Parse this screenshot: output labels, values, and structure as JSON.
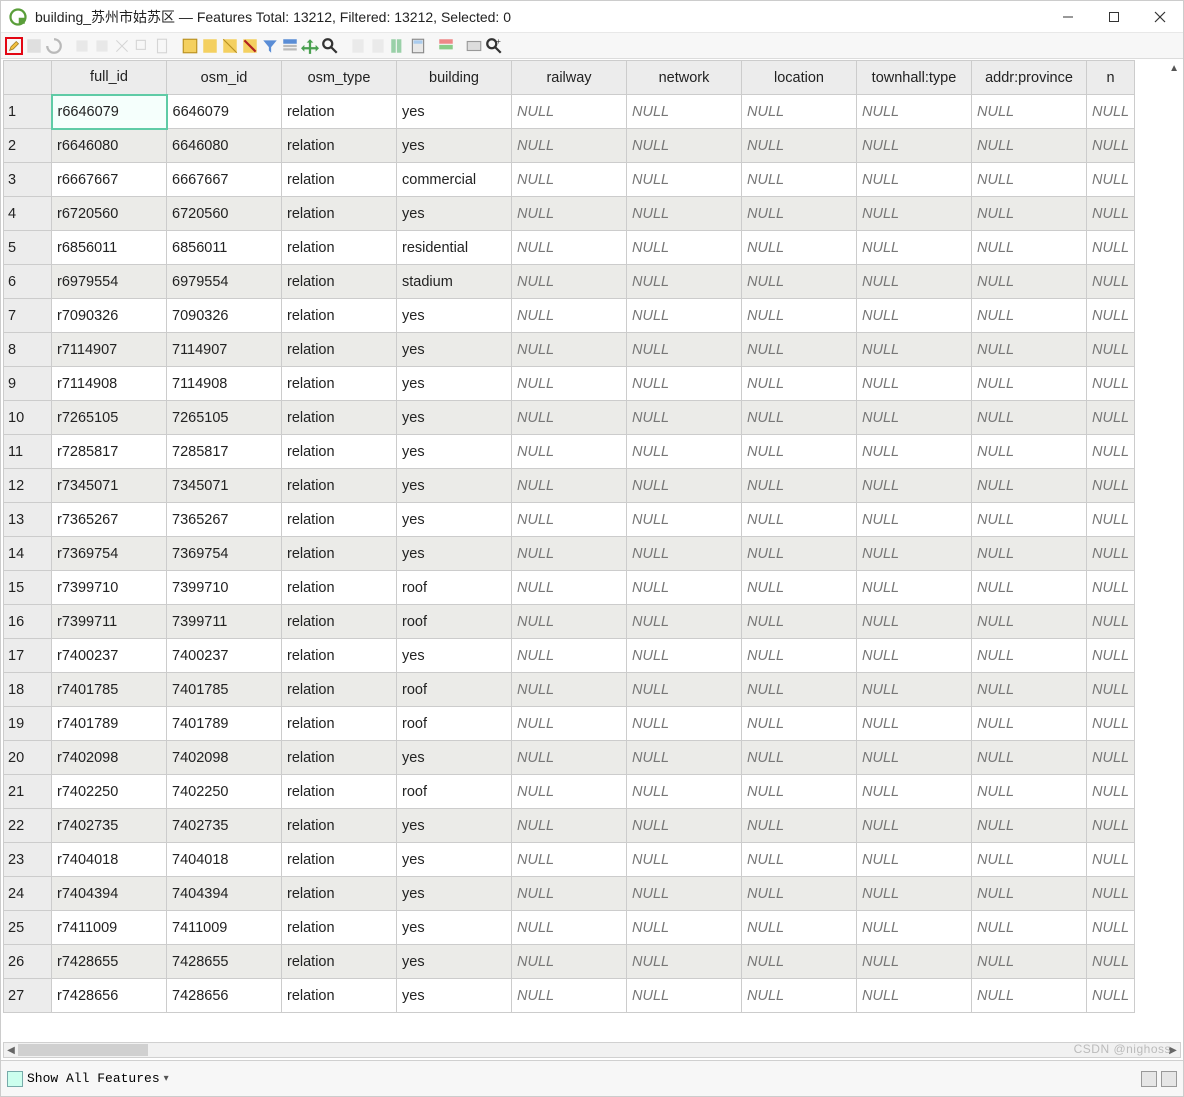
{
  "window": {
    "title": "building_苏州市姑苏区 — Features Total: 13212, Filtered: 13212, Selected: 0"
  },
  "columns": [
    "full_id",
    "osm_id",
    "osm_type",
    "building",
    "railway",
    "network",
    "location",
    "townhall:type",
    "addr:province",
    "n"
  ],
  "null_label": "NULL",
  "rows": [
    {
      "n": 1,
      "full_id": "r6646079",
      "osm_id": "6646079",
      "osm_type": "relation",
      "building": "yes"
    },
    {
      "n": 2,
      "full_id": "r6646080",
      "osm_id": "6646080",
      "osm_type": "relation",
      "building": "yes"
    },
    {
      "n": 3,
      "full_id": "r6667667",
      "osm_id": "6667667",
      "osm_type": "relation",
      "building": "commercial"
    },
    {
      "n": 4,
      "full_id": "r6720560",
      "osm_id": "6720560",
      "osm_type": "relation",
      "building": "yes"
    },
    {
      "n": 5,
      "full_id": "r6856011",
      "osm_id": "6856011",
      "osm_type": "relation",
      "building": "residential"
    },
    {
      "n": 6,
      "full_id": "r6979554",
      "osm_id": "6979554",
      "osm_type": "relation",
      "building": "stadium"
    },
    {
      "n": 7,
      "full_id": "r7090326",
      "osm_id": "7090326",
      "osm_type": "relation",
      "building": "yes"
    },
    {
      "n": 8,
      "full_id": "r7114907",
      "osm_id": "7114907",
      "osm_type": "relation",
      "building": "yes"
    },
    {
      "n": 9,
      "full_id": "r7114908",
      "osm_id": "7114908",
      "osm_type": "relation",
      "building": "yes"
    },
    {
      "n": 10,
      "full_id": "r7265105",
      "osm_id": "7265105",
      "osm_type": "relation",
      "building": "yes"
    },
    {
      "n": 11,
      "full_id": "r7285817",
      "osm_id": "7285817",
      "osm_type": "relation",
      "building": "yes"
    },
    {
      "n": 12,
      "full_id": "r7345071",
      "osm_id": "7345071",
      "osm_type": "relation",
      "building": "yes"
    },
    {
      "n": 13,
      "full_id": "r7365267",
      "osm_id": "7365267",
      "osm_type": "relation",
      "building": "yes"
    },
    {
      "n": 14,
      "full_id": "r7369754",
      "osm_id": "7369754",
      "osm_type": "relation",
      "building": "yes"
    },
    {
      "n": 15,
      "full_id": "r7399710",
      "osm_id": "7399710",
      "osm_type": "relation",
      "building": "roof"
    },
    {
      "n": 16,
      "full_id": "r7399711",
      "osm_id": "7399711",
      "osm_type": "relation",
      "building": "roof"
    },
    {
      "n": 17,
      "full_id": "r7400237",
      "osm_id": "7400237",
      "osm_type": "relation",
      "building": "yes"
    },
    {
      "n": 18,
      "full_id": "r7401785",
      "osm_id": "7401785",
      "osm_type": "relation",
      "building": "roof"
    },
    {
      "n": 19,
      "full_id": "r7401789",
      "osm_id": "7401789",
      "osm_type": "relation",
      "building": "roof"
    },
    {
      "n": 20,
      "full_id": "r7402098",
      "osm_id": "7402098",
      "osm_type": "relation",
      "building": "yes"
    },
    {
      "n": 21,
      "full_id": "r7402250",
      "osm_id": "7402250",
      "osm_type": "relation",
      "building": "roof"
    },
    {
      "n": 22,
      "full_id": "r7402735",
      "osm_id": "7402735",
      "osm_type": "relation",
      "building": "yes"
    },
    {
      "n": 23,
      "full_id": "r7404018",
      "osm_id": "7404018",
      "osm_type": "relation",
      "building": "yes"
    },
    {
      "n": 24,
      "full_id": "r7404394",
      "osm_id": "7404394",
      "osm_type": "relation",
      "building": "yes"
    },
    {
      "n": 25,
      "full_id": "r7411009",
      "osm_id": "7411009",
      "osm_type": "relation",
      "building": "yes"
    },
    {
      "n": 26,
      "full_id": "r7428655",
      "osm_id": "7428655",
      "osm_type": "relation",
      "building": "yes"
    },
    {
      "n": 27,
      "full_id": "r7428656",
      "osm_id": "7428656",
      "osm_type": "relation",
      "building": "yes"
    }
  ],
  "status": {
    "filter_label": "Show All Features"
  },
  "watermark": "CSDN @nighoss"
}
